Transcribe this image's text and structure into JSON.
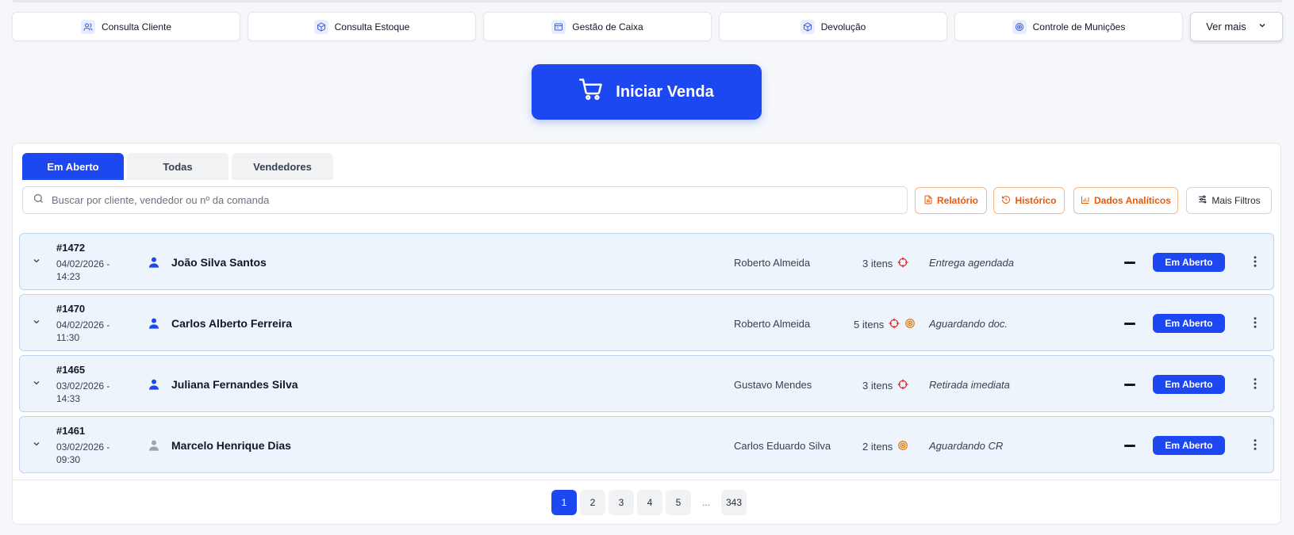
{
  "quick_actions": [
    {
      "label": "Consulta Cliente",
      "icon": "users-icon"
    },
    {
      "label": "Consulta Estoque",
      "icon": "box-icon"
    },
    {
      "label": "Gestão de Caixa",
      "icon": "cash-register-icon"
    },
    {
      "label": "Devolução",
      "icon": "box-return-icon"
    },
    {
      "label": "Controle de Munições",
      "icon": "target-icon"
    }
  ],
  "more_label": "Ver mais",
  "start_sale_label": "Iniciar Venda",
  "tabs": [
    {
      "label": "Em Aberto",
      "active": true
    },
    {
      "label": "Todas",
      "active": false
    },
    {
      "label": "Vendedores",
      "active": false
    }
  ],
  "search": {
    "placeholder": "Buscar por cliente, vendedor ou nº da comanda"
  },
  "filters": {
    "report": "Relatório",
    "history": "Histórico",
    "analytics": "Dados Analíticos",
    "more_filters": "Mais Filtros"
  },
  "orders": [
    {
      "number": "#1472",
      "date": "04/02/2026 -",
      "time": "14:23",
      "customer": "João Silva Santos",
      "customer_active": true,
      "seller": "Roberto Almeida",
      "items": "3 itens",
      "item_icons": [
        "crosshair-icon"
      ],
      "note": "Entrega agendada",
      "status": "Em Aberto"
    },
    {
      "number": "#1470",
      "date": "04/02/2026 -",
      "time": "11:30",
      "customer": "Carlos Alberto Ferreira",
      "customer_active": true,
      "seller": "Roberto Almeida",
      "items": "5 itens",
      "item_icons": [
        "crosshair-icon",
        "target-icon"
      ],
      "note": "Aguardando doc.",
      "status": "Em Aberto"
    },
    {
      "number": "#1465",
      "date": "03/02/2026 -",
      "time": "14:33",
      "customer": "Juliana Fernandes Silva",
      "customer_active": true,
      "seller": "Gustavo Mendes",
      "items": "3 itens",
      "item_icons": [
        "crosshair-icon"
      ],
      "note": "Retirada imediata",
      "status": "Em Aberto"
    },
    {
      "number": "#1461",
      "date": "03/02/2026 -",
      "time": "09:30",
      "customer": "Marcelo Henrique Dias",
      "customer_active": false,
      "seller": "Carlos Eduardo Silva",
      "items": "2 itens",
      "item_icons": [
        "target-icon"
      ],
      "note": "Aguardando CR",
      "status": "Em Aberto"
    }
  ],
  "pagination": {
    "pages": [
      "1",
      "2",
      "3",
      "4",
      "5"
    ],
    "ellipsis": "...",
    "last": "343",
    "current": "1"
  },
  "colors": {
    "accent": "#1d47f0",
    "orange": "#e8590c",
    "crosshair": "#dc2626",
    "target": "#d97706"
  }
}
